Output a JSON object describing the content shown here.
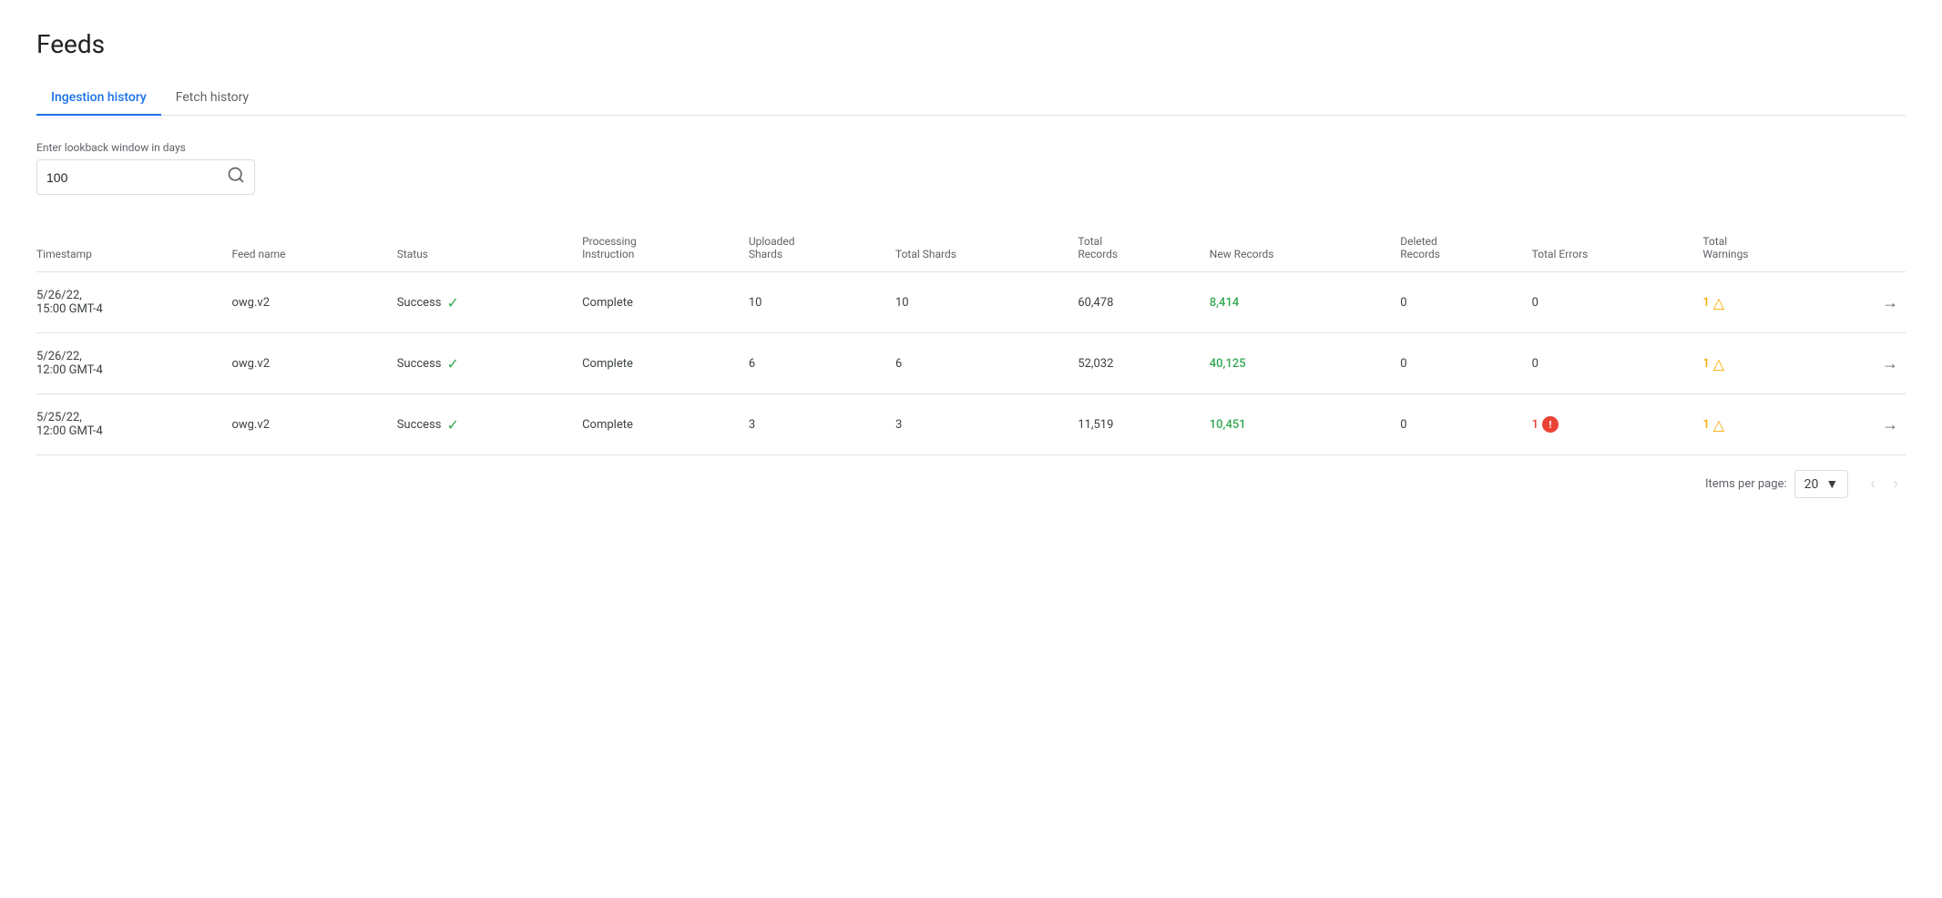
{
  "page": {
    "title": "Feeds"
  },
  "tabs": [
    {
      "id": "ingestion",
      "label": "Ingestion history",
      "active": true
    },
    {
      "id": "fetch",
      "label": "Fetch history",
      "active": false
    }
  ],
  "search": {
    "label": "Enter lookback window in days",
    "value": "100",
    "placeholder": "100"
  },
  "table": {
    "columns": [
      {
        "id": "timestamp",
        "label": "Timestamp"
      },
      {
        "id": "feed_name",
        "label": "Feed name"
      },
      {
        "id": "status",
        "label": "Status"
      },
      {
        "id": "processing_instruction",
        "label": "Processing\nInstruction"
      },
      {
        "id": "uploaded_shards",
        "label": "Uploaded\nShards"
      },
      {
        "id": "total_shards",
        "label": "Total Shards"
      },
      {
        "id": "total_records",
        "label": "Total\nRecords"
      },
      {
        "id": "new_records",
        "label": "New Records"
      },
      {
        "id": "deleted_records",
        "label": "Deleted\nRecords"
      },
      {
        "id": "total_errors",
        "label": "Total Errors"
      },
      {
        "id": "total_warnings",
        "label": "Total\nWarnings"
      },
      {
        "id": "nav",
        "label": ""
      }
    ],
    "rows": [
      {
        "timestamp": "5/26/22,\n15:00 GMT-4",
        "feed_name": "owg.v2",
        "status": "Success",
        "processing_instruction": "Complete",
        "uploaded_shards": "10",
        "total_shards": "10",
        "total_records": "60,478",
        "new_records": "8,414",
        "deleted_records": "0",
        "total_errors": "0",
        "total_errors_count": 0,
        "total_warnings": "1",
        "total_warnings_count": 1
      },
      {
        "timestamp": "5/26/22,\n12:00 GMT-4",
        "feed_name": "owg.v2",
        "status": "Success",
        "processing_instruction": "Complete",
        "uploaded_shards": "6",
        "total_shards": "6",
        "total_records": "52,032",
        "new_records": "40,125",
        "deleted_records": "0",
        "total_errors": "0",
        "total_errors_count": 0,
        "total_warnings": "1",
        "total_warnings_count": 1
      },
      {
        "timestamp": "5/25/22,\n12:00 GMT-4",
        "feed_name": "owg.v2",
        "status": "Success",
        "processing_instruction": "Complete",
        "uploaded_shards": "3",
        "total_shards": "3",
        "total_records": "11,519",
        "new_records": "10,451",
        "deleted_records": "0",
        "total_errors": "1",
        "total_errors_count": 1,
        "total_warnings": "1",
        "total_warnings_count": 1
      }
    ]
  },
  "pagination": {
    "items_per_page_label": "Items per page:",
    "items_per_page_value": "20"
  }
}
